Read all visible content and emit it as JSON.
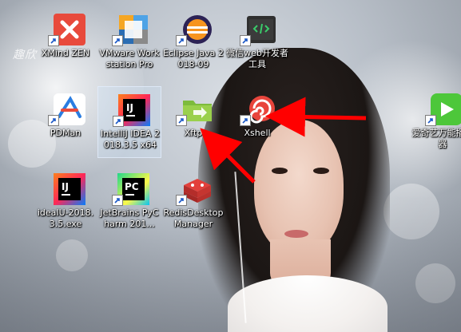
{
  "wallpaper": {
    "signature_text": "趣欣",
    "accent_red": "#ff0000"
  },
  "icons": [
    {
      "label": "XMind ZEN",
      "icon": "xmind-icon"
    },
    {
      "label": "VMware Workstation Pro",
      "icon": "vmware-icon"
    },
    {
      "label": "Eclipse Java 2018-09",
      "icon": "eclipse-icon"
    },
    {
      "label": "微信web开发者工具",
      "icon": "wechat-devtools-icon"
    },
    {
      "label": "PDMan",
      "icon": "pdman-icon"
    },
    {
      "label": "IntelliJ IDEA 2018.3.5 x64",
      "icon": "intellij-idea-icon"
    },
    {
      "label": "Xftp",
      "icon": "xftp-icon"
    },
    {
      "label": "Xshell",
      "icon": "xshell-icon"
    },
    {
      "label": "爱奇艺万能播放器",
      "icon": "iqiyi-player-icon"
    },
    {
      "label": "ideaIU-2018.3.5.exe",
      "icon": "ideaiu-exe-icon"
    },
    {
      "label": "JetBrains PyCharm 201...",
      "icon": "pycharm-icon"
    },
    {
      "label": "RedisDesktopManager",
      "icon": "redis-desktop-manager-icon"
    }
  ]
}
